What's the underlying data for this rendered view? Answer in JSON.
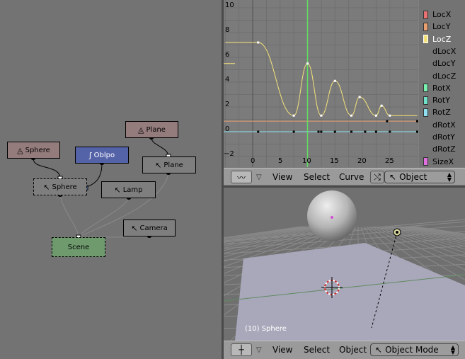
{
  "oops": {
    "nodes": {
      "sphere": "Sphere",
      "oblpo": "Oblpo",
      "plane_top": "Plane",
      "plane": "Plane",
      "sphere_obj": "Sphere",
      "lamp": "Lamp",
      "camera": "Camera",
      "scene": "Scene"
    },
    "colors": {
      "material": "#957c7c",
      "ipo": "#5462a8",
      "object": "#7e7e7e",
      "scene": "#6e9a6e"
    }
  },
  "ipo_editor": {
    "y_ticks": [
      "10",
      "8",
      "6",
      "4",
      "2",
      "0",
      "−2"
    ],
    "x_ticks": [
      "0",
      "5",
      "10",
      "15",
      "20",
      "25"
    ],
    "current_frame": 10,
    "channels": [
      {
        "name": "LocX",
        "color": "#e87272",
        "has_curve": true
      },
      {
        "name": "LocY",
        "color": "#e8a070",
        "has_curve": true
      },
      {
        "name": "LocZ",
        "color": "#f4e27a",
        "has_curve": true,
        "selected": true
      },
      {
        "name": "dLocX",
        "color": "",
        "has_curve": false
      },
      {
        "name": "dLocY",
        "color": "",
        "has_curve": false
      },
      {
        "name": "dLocZ",
        "color": "",
        "has_curve": false
      },
      {
        "name": "RotX",
        "color": "#7af0b0",
        "has_curve": true
      },
      {
        "name": "RotY",
        "color": "#70e0c8",
        "has_curve": true
      },
      {
        "name": "RotZ",
        "color": "#8ee0f0",
        "has_curve": true
      },
      {
        "name": "dRotX",
        "color": "",
        "has_curve": false
      },
      {
        "name": "dRotY",
        "color": "",
        "has_curve": false
      },
      {
        "name": "dRotZ",
        "color": "",
        "has_curve": false
      },
      {
        "name": "SizeX",
        "color": "#e070e0",
        "has_curve": true
      }
    ],
    "header": {
      "view": "View",
      "select": "Select",
      "curve": "Curve",
      "object": "Object"
    }
  },
  "viewport": {
    "object_label": "(10) Sphere",
    "header": {
      "view": "View",
      "select": "Select",
      "object": "Object",
      "mode": "Object Mode"
    }
  }
}
